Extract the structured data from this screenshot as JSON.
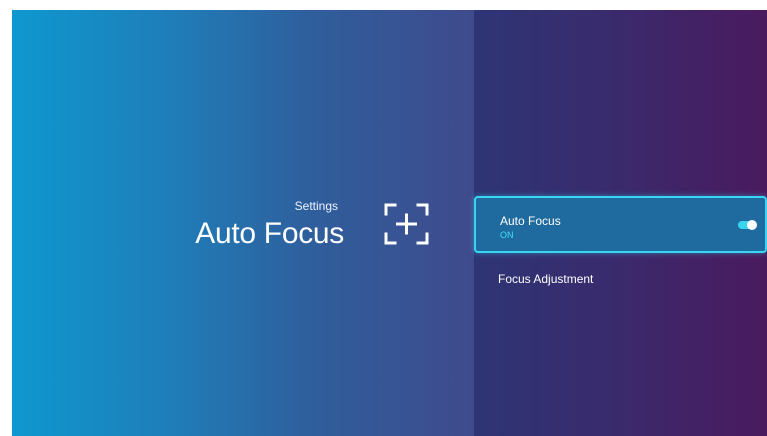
{
  "header": {
    "breadcrumb": "Settings",
    "title": "Auto Focus",
    "icon": "focus-frame-plus-icon"
  },
  "menu": {
    "items": [
      {
        "label": "Auto Focus",
        "value": "ON",
        "toggle_on": true,
        "selected": true
      },
      {
        "label": "Focus Adjustment",
        "selected": false
      }
    ]
  },
  "colors": {
    "accent": "#38d6f2",
    "left_gradient_start": "#0e98cf",
    "left_gradient_end": "#3f4a8c",
    "right_gradient_start": "#2e3575",
    "right_gradient_end": "#4a1a5e",
    "selected_bg": "#1f6a9e"
  }
}
